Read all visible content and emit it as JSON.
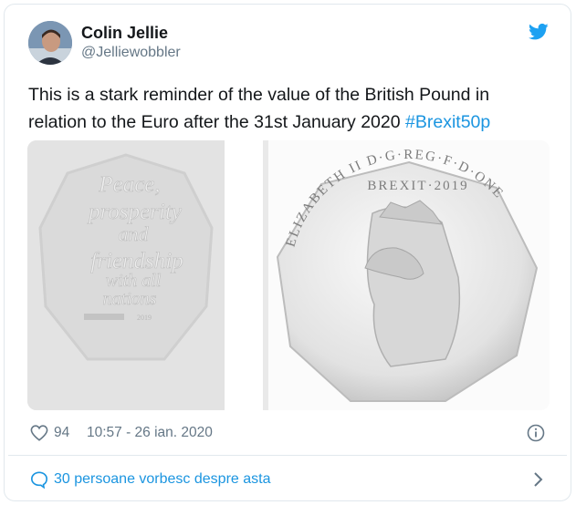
{
  "tweet": {
    "author": {
      "display_name": "Colin Jellie",
      "handle": "@Jelliewobbler"
    },
    "text": "This is a stark reminder of the value of the British Pound in relation to the Euro after the 31st January 2020 ",
    "hashtag": "#Brexit50p",
    "media": {
      "left_coin": {
        "lines": [
          "Peace,",
          "prosperity",
          "and",
          "friendship",
          "with all",
          "nations"
        ],
        "year": "2019"
      },
      "right_coin": {
        "top_text": "BREXIT·2019",
        "side_text": "ELIZABETH II D·G·REG·F·D·ONE"
      }
    },
    "likes": "94",
    "timestamp": "10:57 - 26 ian. 2020",
    "conversation": "30 persoane vorbesc despre asta"
  },
  "colors": {
    "link": "#1b95e0",
    "muted": "#657786",
    "text": "#14171a",
    "border": "#e1e8ed"
  },
  "icons": [
    "twitter-bird-icon",
    "heart-icon",
    "info-icon",
    "speech-bubble-icon",
    "chevron-right-icon"
  ]
}
